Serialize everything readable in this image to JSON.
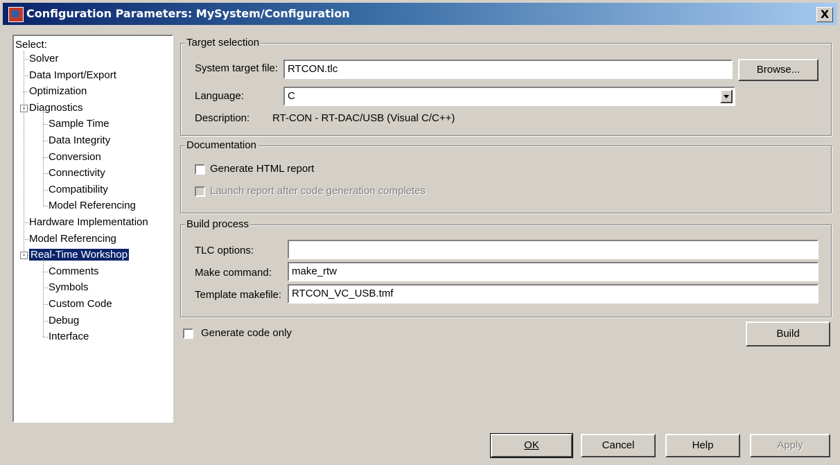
{
  "window": {
    "title": "Configuration Parameters: MySystem/Configuration",
    "close_label": "X"
  },
  "tree": {
    "select_label": "Select:",
    "items": [
      {
        "label": "Solver",
        "level": 1
      },
      {
        "label": "Data Import/Export",
        "level": 1
      },
      {
        "label": "Optimization",
        "level": 1
      },
      {
        "label": "Diagnostics",
        "level": 1,
        "expander": "-"
      },
      {
        "label": "Sample Time",
        "level": 2
      },
      {
        "label": "Data Integrity",
        "level": 2
      },
      {
        "label": "Conversion",
        "level": 2
      },
      {
        "label": "Connectivity",
        "level": 2
      },
      {
        "label": "Compatibility",
        "level": 2
      },
      {
        "label": "Model Referencing",
        "level": 2
      },
      {
        "label": "Hardware Implementation",
        "level": 1
      },
      {
        "label": "Model Referencing",
        "level": 1
      },
      {
        "label": "Real-Time Workshop",
        "level": 1,
        "expander": "-",
        "selected": true
      },
      {
        "label": "Comments",
        "level": 2
      },
      {
        "label": "Symbols",
        "level": 2
      },
      {
        "label": "Custom Code",
        "level": 2
      },
      {
        "label": "Debug",
        "level": 2
      },
      {
        "label": "Interface",
        "level": 2
      }
    ]
  },
  "target_selection": {
    "title": "Target selection",
    "system_target_label": "System target file:",
    "system_target_value": "RTCON.tlc",
    "browse_label": "Browse...",
    "language_label": "Language:",
    "language_value": "C",
    "description_label": "Description:",
    "description_value": "RT-CON - RT-DAC/USB (Visual C/C++)"
  },
  "documentation": {
    "title": "Documentation",
    "generate_html_label": "Generate HTML report",
    "launch_report_label": "Launch report after code generation completes"
  },
  "build_process": {
    "title": "Build process",
    "tlc_options_label": "TLC options:",
    "tlc_options_value": "",
    "make_command_label": "Make command:",
    "make_command_value": "make_rtw",
    "template_makefile_label": "Template makefile:",
    "template_makefile_value": "RTCON_VC_USB.tmf"
  },
  "generate_code_only_label": "Generate code only",
  "build_label": "Build",
  "buttons": {
    "ok_label": "OK",
    "cancel_label": "Cancel",
    "help_label": "Help",
    "apply_label": "Apply"
  }
}
